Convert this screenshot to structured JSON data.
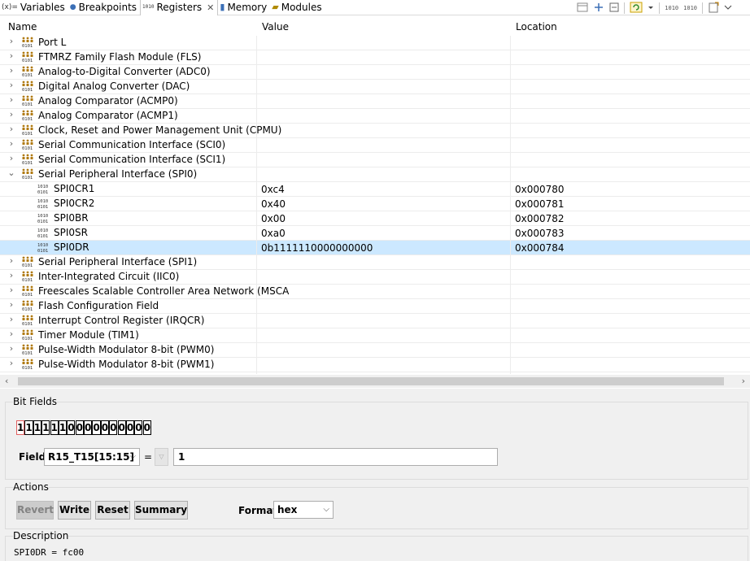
{
  "tabs": [
    {
      "label": "Variables",
      "icon": "(x)="
    },
    {
      "label": "Breakpoints",
      "icon": "●"
    },
    {
      "label": "Registers",
      "icon": "1010"
    },
    {
      "label": "Memory",
      "icon": "▮"
    },
    {
      "label": "Modules",
      "icon": "▰"
    }
  ],
  "toolbar_icons": [
    "layout-icon",
    "pin-icon",
    "minimize-icon",
    "refresh-icon",
    "dropdown-icon",
    "bits-icon",
    "bits-icon",
    "new-icon",
    "menu-icon"
  ],
  "table": {
    "headers": {
      "name": "Name",
      "value": "Value",
      "location": "Location"
    },
    "rows": [
      {
        "kind": "group",
        "expanded": false,
        "name": "Port L",
        "value": "",
        "location": ""
      },
      {
        "kind": "group",
        "expanded": false,
        "name": "FTMRZ Family Flash Module (FLS)",
        "value": "",
        "location": ""
      },
      {
        "kind": "group",
        "expanded": false,
        "name": "Analog-to-Digital Converter (ADC0)",
        "value": "",
        "location": ""
      },
      {
        "kind": "group",
        "expanded": false,
        "name": "Digital Analog Converter (DAC)",
        "value": "",
        "location": ""
      },
      {
        "kind": "group",
        "expanded": false,
        "name": "Analog Comparator (ACMP0)",
        "value": "",
        "location": ""
      },
      {
        "kind": "group",
        "expanded": false,
        "name": "Analog Comparator (ACMP1)",
        "value": "",
        "location": ""
      },
      {
        "kind": "group",
        "expanded": false,
        "name": "Clock, Reset and Power Management Unit (CPMU)",
        "value": "",
        "location": ""
      },
      {
        "kind": "group",
        "expanded": false,
        "name": "Serial Communication Interface (SCI0)",
        "value": "",
        "location": ""
      },
      {
        "kind": "group",
        "expanded": false,
        "name": "Serial Communication Interface (SCI1)",
        "value": "",
        "location": ""
      },
      {
        "kind": "group",
        "expanded": true,
        "name": "Serial Peripheral Interface (SPI0)",
        "value": "",
        "location": ""
      },
      {
        "kind": "register",
        "name": "SPI0CR1",
        "value": "0xc4",
        "location": "0x000780"
      },
      {
        "kind": "register",
        "name": "SPI0CR2",
        "value": "0x40",
        "location": "0x000781"
      },
      {
        "kind": "register",
        "name": "SPI0BR",
        "value": "0x00",
        "location": "0x000782"
      },
      {
        "kind": "register",
        "name": "SPI0SR",
        "value": "0xa0",
        "location": "0x000783"
      },
      {
        "kind": "register",
        "name": "SPI0DR",
        "value": "0b1111110000000000",
        "location": "0x000784",
        "selected": true
      },
      {
        "kind": "group",
        "expanded": false,
        "name": "Serial Peripheral Interface (SPI1)",
        "value": "",
        "location": ""
      },
      {
        "kind": "group",
        "expanded": false,
        "name": "Inter-Integrated Circuit (IIC0)",
        "value": "",
        "location": ""
      },
      {
        "kind": "group",
        "expanded": false,
        "name": "Freescales Scalable Controller Area Network (MSCA",
        "value": "",
        "location": ""
      },
      {
        "kind": "group",
        "expanded": false,
        "name": "Flash Configuration Field",
        "value": "",
        "location": ""
      },
      {
        "kind": "group",
        "expanded": false,
        "name": "Interrupt Control Register (IRQCR)",
        "value": "",
        "location": ""
      },
      {
        "kind": "group",
        "expanded": false,
        "name": "Timer Module (TIM1)",
        "value": "",
        "location": ""
      },
      {
        "kind": "group",
        "expanded": false,
        "name": "Pulse-Width Modulator 8-bit (PWM0)",
        "value": "",
        "location": ""
      },
      {
        "kind": "group",
        "expanded": false,
        "name": "Pulse-Width Modulator 8-bit (PWM1)",
        "value": "",
        "location": ""
      }
    ]
  },
  "bit_fields": {
    "title": "Bit Fields",
    "bits": [
      "1",
      "1",
      "1",
      "1",
      "1",
      "1",
      "0",
      "0",
      "0",
      "0",
      "0",
      "0",
      "0",
      "0",
      "0",
      "0"
    ],
    "field_label": "Field",
    "field_selected": "R15_T15[15:15]",
    "equals": "=",
    "spin_glyph": "▽",
    "field_value": "1"
  },
  "actions": {
    "title": "Actions",
    "revert": "Revert",
    "write": "Write",
    "reset": "Reset",
    "summary": "Summary",
    "format_label": "Format",
    "format_selected": "hex"
  },
  "description": {
    "title": "Description",
    "text": "SPI0DR = fc00"
  },
  "glyphs": {
    "chevron_right": "›",
    "chevron_down": "⌄",
    "close": "✕",
    "caret": "⌵",
    "scroll_left": "‹",
    "scroll_right": "›"
  }
}
